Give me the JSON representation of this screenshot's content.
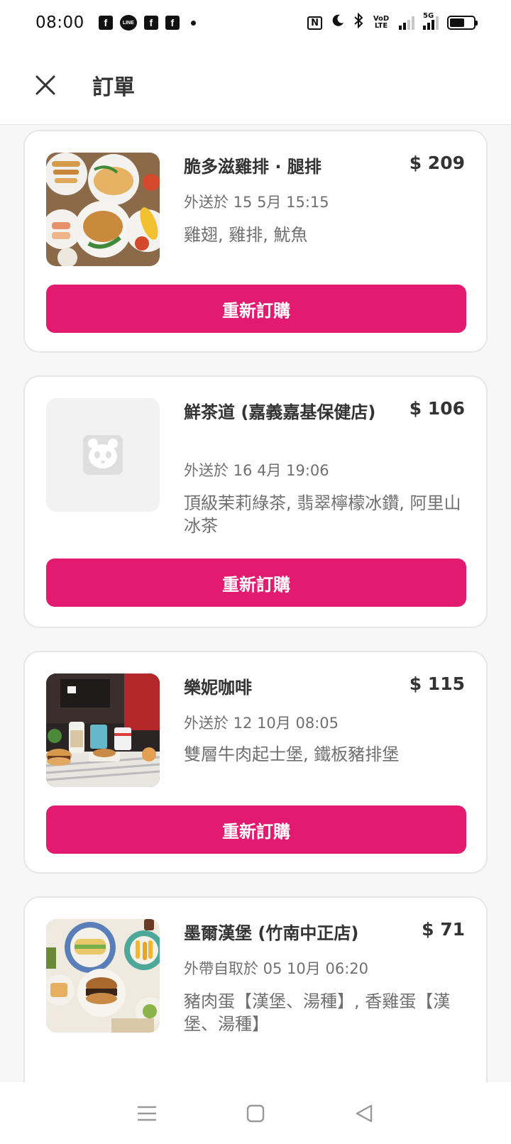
{
  "status_bar": {
    "time": "08:00",
    "left_icons": [
      "facebook-icon",
      "line-icon",
      "facebook-icon",
      "facebook-icon"
    ],
    "line_label": "LINE",
    "fb_label": "f",
    "nfc_label": "N",
    "volte_label": "VoD LTE",
    "network_label": "5G",
    "battery_percent": 62
  },
  "header": {
    "title": "訂單"
  },
  "orders": [
    {
      "vendor": "脆多滋雞排 · 腿排",
      "price": "$ 209",
      "date": "外送於 15 5月 15:15",
      "items": "雞翅, 雞排, 魷魚",
      "reorder_label": "重新訂購",
      "image": "fried-chicken-photo"
    },
    {
      "vendor": "鮮茶道 (嘉義嘉基保健店)",
      "price": "$ 106",
      "date": "外送於 16 4月 19:06",
      "items": "頂級茉莉綠茶, 翡翠檸檬冰鑽, 阿里山冰茶",
      "reorder_label": "重新訂購",
      "image": "panda-placeholder-icon"
    },
    {
      "vendor": "樂妮咖啡",
      "price": "$ 115",
      "date": "外送於 12 10月 08:05",
      "items": "雙層牛肉起士堡, 鐵板豬排堡",
      "reorder_label": "重新訂購",
      "image": "burger-cafe-photo"
    },
    {
      "vendor": "墨爾漢堡 (竹南中正店)",
      "price": "$ 71",
      "date": "外帶自取於 05 10月 06:20",
      "items": "豬肉蛋【漢堡、湯種】, 香雞蛋【漢堡、湯種】",
      "image": "breakfast-plates-photo"
    }
  ],
  "colors": {
    "brand_pink": "#e21b70",
    "text_primary": "#333333",
    "text_secondary": "#707070",
    "background": "#f7f7f7"
  },
  "nav_bar": {
    "icons": [
      "menu-icon",
      "home-icon",
      "back-icon"
    ]
  }
}
